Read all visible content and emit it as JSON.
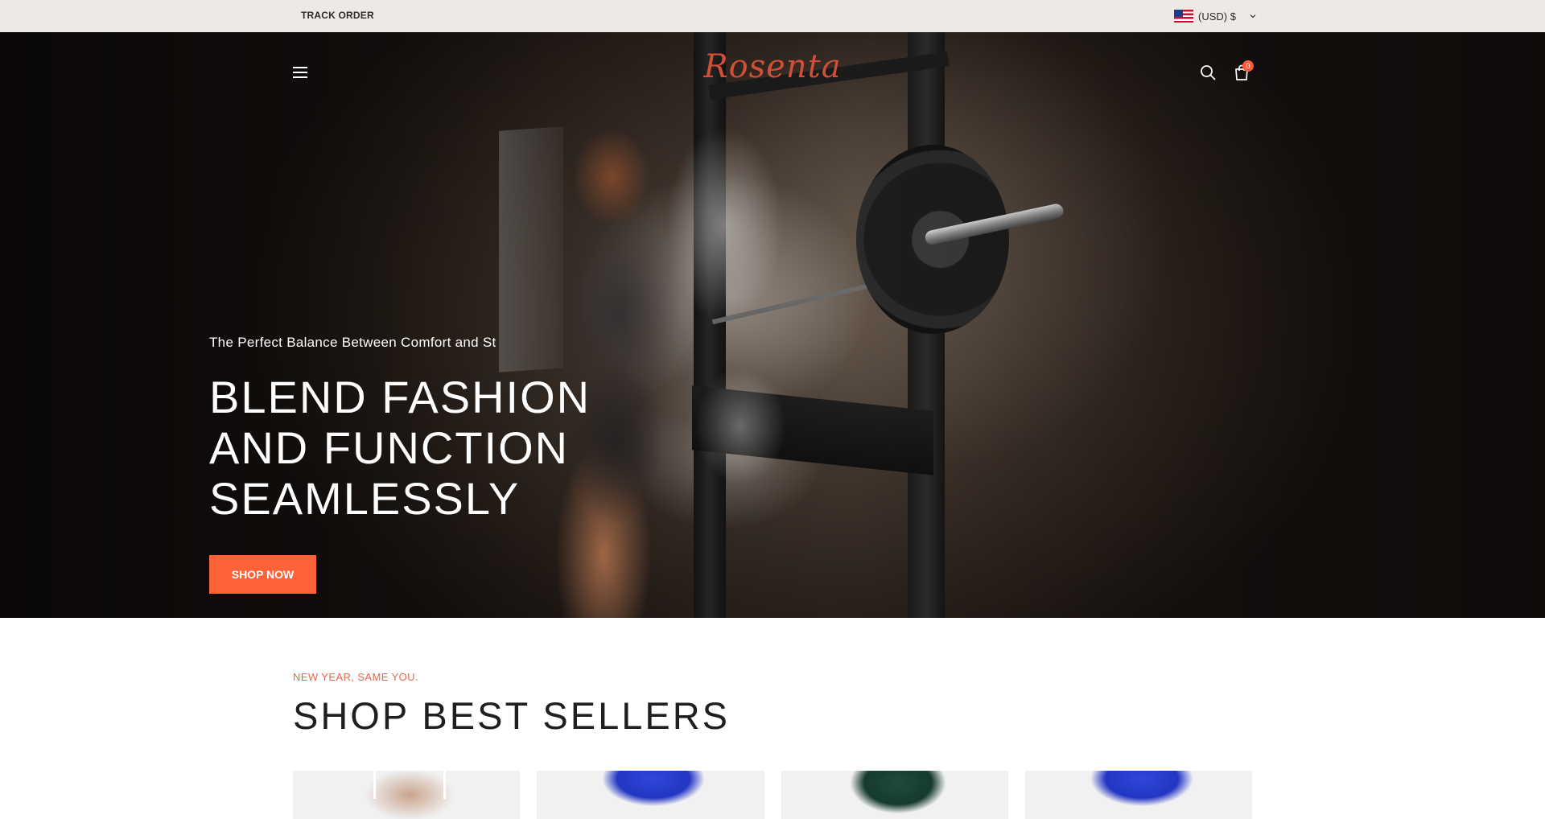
{
  "topbar": {
    "track_order": "TRACK ORDER",
    "currency": "(USD) $",
    "flag_icon": "us-flag-icon"
  },
  "header": {
    "logo": "Rosenta",
    "cart_count": "0",
    "icons": [
      "menu-icon",
      "search-icon",
      "cart-icon"
    ]
  },
  "hero": {
    "subtitle": "The Perfect Balance Between Comfort and St",
    "title_lines": [
      "BLEND FASHION",
      "AND FUNCTION",
      "SEAMLESSLY"
    ],
    "cta": "SHOP NOW"
  },
  "best_sellers": {
    "eyebrow": "NEW YEAR, SAME YOU.",
    "title": "SHOP BEST SELLERS"
  },
  "colors": {
    "accent": "#ff6238",
    "logo": "#cf5037",
    "eyebrow": "#e4674a",
    "topbar_bg": "#efe9e6"
  }
}
